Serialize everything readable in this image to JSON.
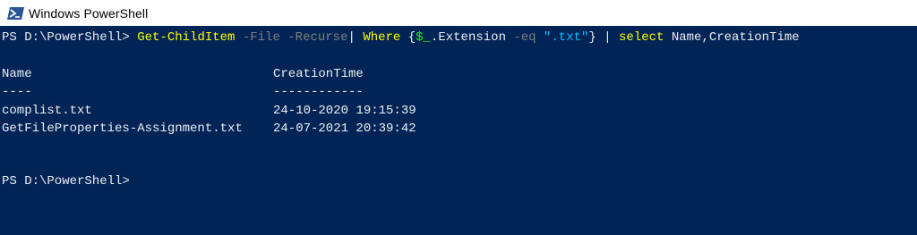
{
  "window": {
    "title": "Windows PowerShell",
    "icon": "powershell-icon",
    "colors": {
      "console_bg": "#012456",
      "text": "#eeedf0",
      "command": "#ffff00",
      "parameter": "#808080",
      "string": "#00bfff",
      "variable": "#00ff00"
    }
  },
  "command_line": {
    "prompt": "PS D:\\PowerShell> ",
    "cmdlet": "Get-ChildItem",
    "param_file": " -File",
    "param_recurse": " -Recurse",
    "pipe1": "| ",
    "where": "Where",
    "brace_open": " {",
    "var": "$_",
    "prop": ".Extension",
    "op": " -eq",
    "space": " ",
    "str": "\".txt\"",
    "brace_close": "} | ",
    "select": "select",
    "select_args": " Name,CreationTime"
  },
  "output": {
    "headers": [
      "Name",
      "CreationTime"
    ],
    "dividers": [
      "----",
      "------------"
    ],
    "rows": [
      [
        "complist.txt",
        "24-10-2020 19:15:39"
      ],
      [
        "GetFileProperties-Assignment.txt",
        "24-07-2021 20:39:42"
      ]
    ]
  },
  "final_prompt": "PS D:\\PowerShell>"
}
